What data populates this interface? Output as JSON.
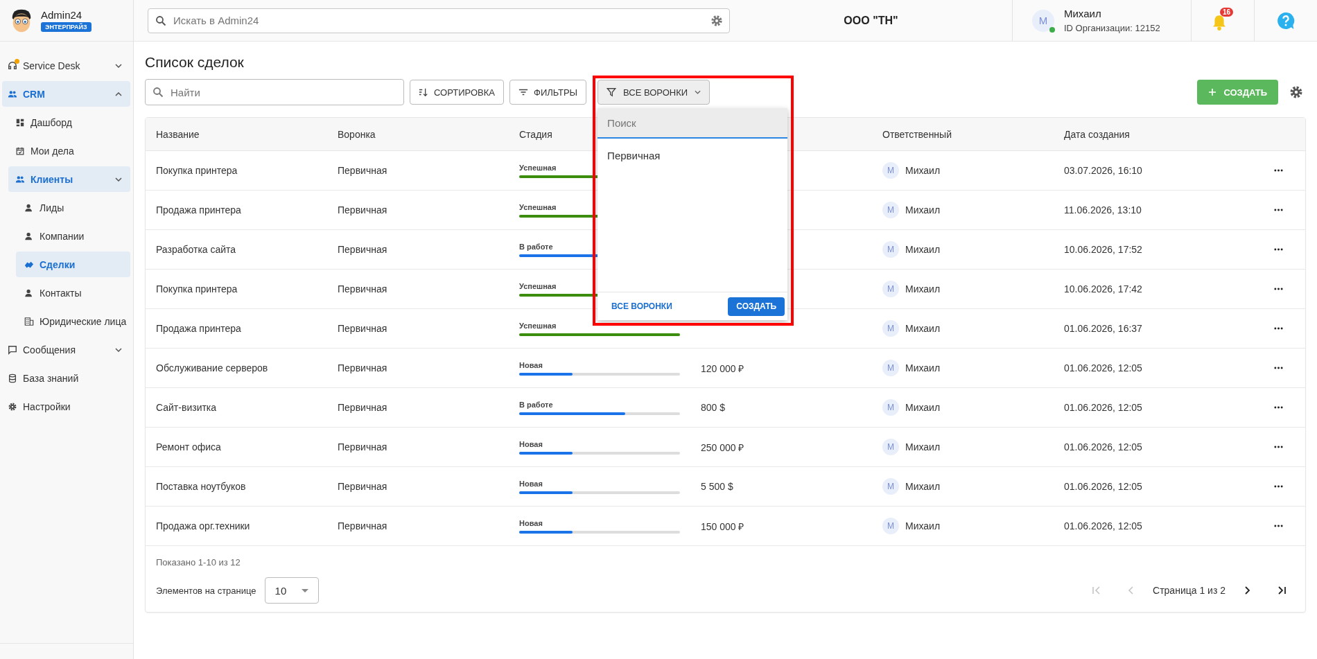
{
  "brand": {
    "name": "Admin24",
    "edition": "ЭНТЕРПРАЙЗ"
  },
  "header": {
    "search": {
      "placeholder": "Искать в Admin24"
    },
    "organization": "ООО \"ТН\"",
    "user": {
      "initial": "M",
      "name": "Михаил",
      "org_id": "ID Организации: 12152",
      "online": true
    },
    "notifications": "16"
  },
  "sidebar": {
    "items": [
      {
        "label": "Service Desk",
        "selected": false,
        "expanded": false,
        "badge": true
      },
      {
        "label": "CRM",
        "selected": true,
        "expanded": true,
        "children": [
          {
            "label": "Дашборд",
            "selected": false
          },
          {
            "label": "Мои дела",
            "selected": false
          },
          {
            "label": "Клиенты",
            "selected": true,
            "expanded": true,
            "children": [
              {
                "label": "Лиды",
                "selected": false
              },
              {
                "label": "Компании",
                "selected": false
              },
              {
                "label": "Сделки",
                "selected": true
              },
              {
                "label": "Контакты",
                "selected": false
              },
              {
                "label": "Юридические лица",
                "selected": false
              }
            ]
          }
        ]
      },
      {
        "label": "Сообщения",
        "selected": false,
        "expanded": false
      },
      {
        "label": "База знаний",
        "selected": false
      },
      {
        "label": "Настройки",
        "selected": false
      }
    ]
  },
  "page": {
    "title": "Список сделок"
  },
  "toolbar": {
    "search": {
      "placeholder": "Найти"
    },
    "sort": "СОРТИРОВКА",
    "filters": "ФИЛЬТРЫ",
    "funnel": "ВСЕ ВОРОНКИ",
    "create": "СОЗДАТЬ"
  },
  "funnel_dropdown": {
    "search": {
      "placeholder": "Поиск"
    },
    "options": [
      "Первичная"
    ],
    "all_link": "ВСЕ ВОРОНКИ",
    "create": "СОЗДАТЬ"
  },
  "table": {
    "columns": [
      "Название",
      "Воронка",
      "Стадия",
      "Ответственный",
      "Дата создания"
    ],
    "rows": [
      {
        "name": "Покупка принтера",
        "funnel": "Первичная",
        "stage": {
          "label": "Успешная",
          "kind": "success",
          "level": 1
        },
        "owner_initial": "M",
        "owner": "Михаил",
        "created": "03.07.2026, 16:10"
      },
      {
        "name": "Продажа принтера",
        "funnel": "Первичная",
        "stage": {
          "label": "Успешная",
          "kind": "success",
          "level": 1
        },
        "owner_initial": "M",
        "owner": "Михаил",
        "created": "11.06.2026, 13:10"
      },
      {
        "name": "Разработка сайта",
        "funnel": "Первичная",
        "stage": {
          "label": "В работе",
          "kind": "progress",
          "level": 0.66
        },
        "owner_initial": "M",
        "owner": "Михаил",
        "created": "10.06.2026, 17:52"
      },
      {
        "name": "Покупка принтера",
        "funnel": "Первичная",
        "stage": {
          "label": "Успешная",
          "kind": "success",
          "level": 1
        },
        "owner_initial": "M",
        "owner": "Михаил",
        "created": "10.06.2026, 17:42"
      },
      {
        "name": "Продажа принтера",
        "funnel": "Первичная",
        "stage": {
          "label": "Успешная",
          "kind": "success",
          "level": 1
        },
        "owner_initial": "M",
        "owner": "Михаил",
        "created": "01.06.2026, 16:37"
      },
      {
        "name": "Обслуживание серверов",
        "funnel": "Первичная",
        "stage": {
          "label": "Новая",
          "kind": "progress",
          "level": 0.33
        },
        "amount": "120 000 ₽",
        "owner_initial": "M",
        "owner": "Михаил",
        "created": "01.06.2026, 12:05"
      },
      {
        "name": "Сайт-визитка",
        "funnel": "Первичная",
        "stage": {
          "label": "В работе",
          "kind": "progress",
          "level": 0.66
        },
        "amount": "800 $",
        "owner_initial": "M",
        "owner": "Михаил",
        "created": "01.06.2026, 12:05"
      },
      {
        "name": "Ремонт офиса",
        "funnel": "Первичная",
        "stage": {
          "label": "Новая",
          "kind": "progress",
          "level": 0.33
        },
        "amount": "250 000 ₽",
        "owner_initial": "M",
        "owner": "Михаил",
        "created": "01.06.2026, 12:05"
      },
      {
        "name": "Поставка ноутбуков",
        "funnel": "Первичная",
        "stage": {
          "label": "Новая",
          "kind": "progress",
          "level": 0.33
        },
        "amount": "5 500 $",
        "owner_initial": "M",
        "owner": "Михаил",
        "created": "01.06.2026, 12:05"
      },
      {
        "name": "Продажа орг.техники",
        "funnel": "Первичная",
        "stage": {
          "label": "Новая",
          "kind": "progress",
          "level": 0.33
        },
        "amount": "150 000 ₽",
        "owner_initial": "M",
        "owner": "Михаил",
        "created": "01.06.2026, 12:05"
      }
    ]
  },
  "footer": {
    "shown": "Показано 1-10 из 12",
    "page_size_label": "Элементов на странице",
    "page_size": "10",
    "page": "Страница 1 из 2",
    "first_disabled": true,
    "prev_disabled": true,
    "next_disabled": false,
    "last_disabled": false
  }
}
